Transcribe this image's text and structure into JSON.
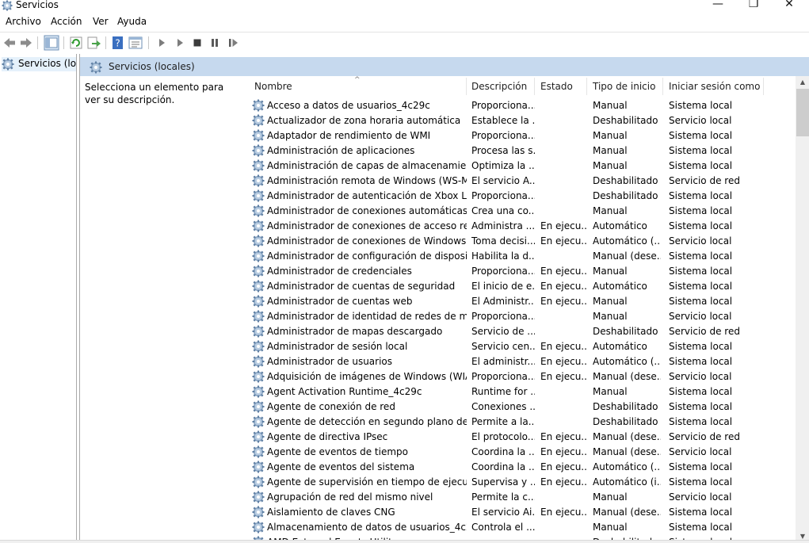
{
  "window": {
    "title": "Servicios",
    "icon": "services-gear-icon",
    "minimize_glyph": "—",
    "maximize_glyph": "❐",
    "close_glyph": "✕"
  },
  "menu": [
    "Archivo",
    "Acción",
    "Ver",
    "Ayuda"
  ],
  "toolbar": [
    "back-icon",
    "forward-icon",
    "show-hide-tree-icon",
    "refresh-icon",
    "export-list-icon",
    "help-icon",
    "properties-icon",
    "start-service-icon",
    "start-service-alt-icon",
    "stop-service-icon",
    "pause-service-icon",
    "restart-service-icon"
  ],
  "tree": {
    "item_label": "Servicios (locales)"
  },
  "header": {
    "label": "Servicios (locales)"
  },
  "description_panel": {
    "text": "Selecciona un elemento para ver su descripción."
  },
  "columns": {
    "name": "Nombre",
    "description": "Descripción",
    "state": "Estado",
    "startup": "Tipo de inicio",
    "logon": "Iniciar sesión como",
    "sort_glyph": "^"
  },
  "rows": [
    {
      "name": "Acceso a datos de usuarios_4c29c",
      "desc": "Proporciona...",
      "state": "",
      "startup": "Manual",
      "logon": "Sistema local"
    },
    {
      "name": "Actualizador de zona horaria automática",
      "desc": "Establece la ...",
      "state": "",
      "startup": "Deshabilitado",
      "logon": "Servicio local"
    },
    {
      "name": "Adaptador de rendimiento de WMI",
      "desc": "Proporciona...",
      "state": "",
      "startup": "Manual",
      "logon": "Sistema local"
    },
    {
      "name": "Administración de aplicaciones",
      "desc": "Procesa las s...",
      "state": "",
      "startup": "Manual",
      "logon": "Sistema local"
    },
    {
      "name": "Administración de capas de almacenamiento",
      "desc": "Optimiza la ...",
      "state": "",
      "startup": "Manual",
      "logon": "Sistema local"
    },
    {
      "name": "Administración remota de Windows (WS-Ma...",
      "desc": "El servicio A...",
      "state": "",
      "startup": "Deshabilitado",
      "logon": "Servicio de red"
    },
    {
      "name": "Administrador de autenticación de Xbox Live",
      "desc": "Proporciona...",
      "state": "",
      "startup": "Deshabilitado",
      "logon": "Sistema local"
    },
    {
      "name": "Administrador de conexiones automáticas de...",
      "desc": "Crea una co...",
      "state": "",
      "startup": "Manual",
      "logon": "Sistema local"
    },
    {
      "name": "Administrador de conexiones de acceso remo...",
      "desc": "Administra ...",
      "state": "En ejecu...",
      "startup": "Automático",
      "logon": "Sistema local"
    },
    {
      "name": "Administrador de conexiones de Windows",
      "desc": "Toma decisi...",
      "state": "En ejecu...",
      "startup": "Automático (...",
      "logon": "Servicio local"
    },
    {
      "name": "Administrador de configuración de dispositivos",
      "desc": "Habilita la d...",
      "state": "",
      "startup": "Manual (dese...",
      "logon": "Sistema local"
    },
    {
      "name": "Administrador de credenciales",
      "desc": "Proporciona...",
      "state": "En ejecu...",
      "startup": "Manual",
      "logon": "Sistema local"
    },
    {
      "name": "Administrador de cuentas de seguridad",
      "desc": "El inicio de e...",
      "state": "En ejecu...",
      "startup": "Automático",
      "logon": "Sistema local"
    },
    {
      "name": "Administrador de cuentas web",
      "desc": "El Administr...",
      "state": "En ejecu...",
      "startup": "Manual",
      "logon": "Sistema local"
    },
    {
      "name": "Administrador de identidad de redes de mism...",
      "desc": "Proporciona...",
      "state": "",
      "startup": "Manual",
      "logon": "Servicio local"
    },
    {
      "name": "Administrador de mapas descargado",
      "desc": "Servicio de ...",
      "state": "",
      "startup": "Deshabilitado",
      "logon": "Servicio de red"
    },
    {
      "name": "Administrador de sesión local",
      "desc": "Servicio cen...",
      "state": "En ejecu...",
      "startup": "Automático",
      "logon": "Sistema local"
    },
    {
      "name": "Administrador de usuarios",
      "desc": "El administr...",
      "state": "En ejecu...",
      "startup": "Automático (...",
      "logon": "Sistema local"
    },
    {
      "name": "Adquisición de imágenes de Windows (WIA)",
      "desc": "Proporciona...",
      "state": "En ejecu...",
      "startup": "Manual (dese...",
      "logon": "Servicio local"
    },
    {
      "name": "Agent Activation Runtime_4c29c",
      "desc": "Runtime for ...",
      "state": "",
      "startup": "Manual",
      "logon": "Sistema local"
    },
    {
      "name": "Agente de conexión de red",
      "desc": "Conexiones ...",
      "state": "",
      "startup": "Deshabilitado",
      "logon": "Sistema local"
    },
    {
      "name": "Agente de detección en segundo plano de De...",
      "desc": "Permite a la...",
      "state": "",
      "startup": "Deshabilitado",
      "logon": "Sistema local"
    },
    {
      "name": "Agente de directiva IPsec",
      "desc": "El protocolo...",
      "state": "En ejecu...",
      "startup": "Manual (dese...",
      "logon": "Servicio de red"
    },
    {
      "name": "Agente de eventos de tiempo",
      "desc": "Coordina la ...",
      "state": "En ejecu...",
      "startup": "Manual (dese...",
      "logon": "Servicio local"
    },
    {
      "name": "Agente de eventos del sistema",
      "desc": "Coordina la ...",
      "state": "En ejecu...",
      "startup": "Automático (...",
      "logon": "Sistema local"
    },
    {
      "name": "Agente de supervisión en tiempo de ejecució...",
      "desc": "Supervisa y ...",
      "state": "En ejecu...",
      "startup": "Automático (i...",
      "logon": "Sistema local"
    },
    {
      "name": "Agrupación de red del mismo nivel",
      "desc": "Permite la c...",
      "state": "",
      "startup": "Manual",
      "logon": "Servicio local"
    },
    {
      "name": "Aislamiento de claves CNG",
      "desc": "El servicio Ai...",
      "state": "En ejecu...",
      "startup": "Manual (dese...",
      "logon": "Sistema local"
    },
    {
      "name": "Almacenamiento de datos de usuarios_4c29c",
      "desc": "Controla el ...",
      "state": "",
      "startup": "Manual",
      "logon": "Sistema local"
    },
    {
      "name": "AMD External Events Utility",
      "desc": "",
      "state": "",
      "startup": "Deshabilitado",
      "logon": "Sistema local"
    }
  ],
  "scrollbar": {
    "up_glyph": "▲",
    "down_glyph": "▼"
  }
}
